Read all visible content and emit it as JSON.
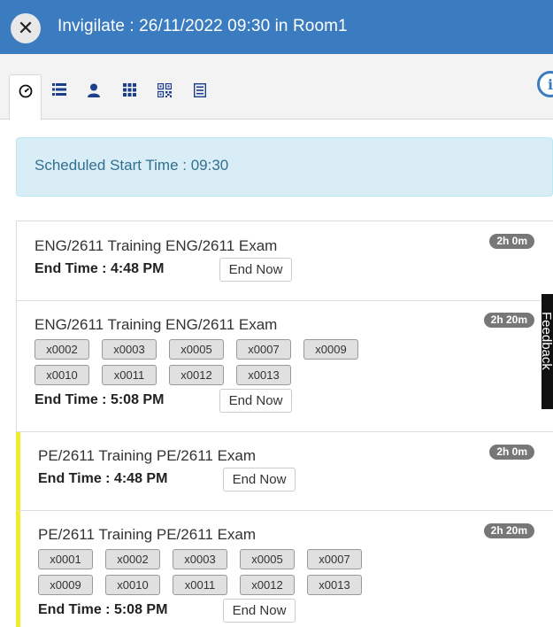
{
  "window": {
    "title": "Invigilate : 26/11/2022 09:30 in Room1",
    "close_glyph": "✕"
  },
  "tabs": [
    {
      "icon": "dashboard-icon",
      "active": true
    },
    {
      "icon": "list-icon",
      "active": false
    },
    {
      "icon": "user-icon",
      "active": false
    },
    {
      "icon": "grid-icon",
      "active": false
    },
    {
      "icon": "qr-code-icon",
      "active": false
    },
    {
      "icon": "report-icon",
      "active": false
    }
  ],
  "info_glyph": "i",
  "alert": {
    "text": "Scheduled Start Time : 09:30"
  },
  "sessions": [
    {
      "title": "ENG/2611 Training ENG/2611 Exam",
      "duration": "2h 0m",
      "end_time": "End Time : 4:48 PM",
      "end_button": "End Now",
      "candidates": [],
      "flag": false
    },
    {
      "title": "ENG/2611 Training ENG/2611 Exam",
      "duration": "2h 20m",
      "end_time": "End Time : 5:08 PM",
      "end_button": "End Now",
      "candidates": [
        "x0002",
        "x0003",
        "x0005",
        "x0007",
        "x0009",
        "x0010",
        "x0011",
        "x0012",
        "x0013"
      ],
      "flag": false
    },
    {
      "title": "PE/2611 Training PE/2611 Exam",
      "duration": "2h 0m",
      "end_time": "End Time : 4:48 PM",
      "end_button": "End Now",
      "candidates": [],
      "flag": true
    },
    {
      "title": "PE/2611 Training PE/2611 Exam",
      "duration": "2h 20m",
      "end_time": "End Time : 5:08 PM",
      "end_button": "End Now",
      "candidates": [
        "x0001",
        "x0002",
        "x0003",
        "x0005",
        "x0007",
        "x0009",
        "x0010",
        "x0011",
        "x0012",
        "x0013"
      ],
      "flag": true
    }
  ],
  "feedback_label": "Feedback",
  "colors": {
    "header": "#3a7cbf",
    "alert_bg": "#d9edf7",
    "alert_text": "#31708f",
    "flag": "#f5ea2a",
    "badge": "#777777"
  }
}
